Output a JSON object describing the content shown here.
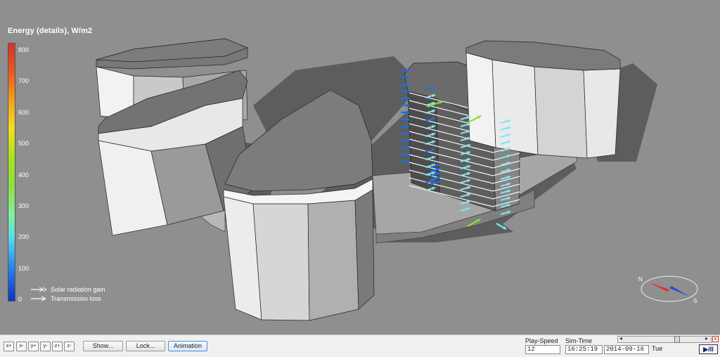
{
  "legend": {
    "title": "Energy (details), W/m2",
    "ticks": [
      "800",
      "700",
      "600",
      "500",
      "400",
      "300",
      "200",
      "100",
      "0"
    ],
    "items": [
      {
        "label": "Solar radiation gain"
      },
      {
        "label": "Transmission loss"
      }
    ]
  },
  "compass": {
    "north": "N",
    "south": "S"
  },
  "toolbar": {
    "axis_buttons": [
      "x+",
      "x-",
      "y+",
      "y-",
      "z+",
      "z-"
    ],
    "show_label": "Show...",
    "lock_label": "Lock...",
    "animation_label": "Animation",
    "play_speed_label": "Play-Speed",
    "play_speed_value": "12",
    "sim_time_label": "Sim-Time",
    "sim_time_value": "16:25:19",
    "sim_date_value": "2014-09-16",
    "weekday": "Tue",
    "slider_left": "◂",
    "slider_right": "▸",
    "close": "x",
    "play_pause": "▶/II"
  },
  "colors": {
    "background": "#8f8f8f",
    "building_light": "#f4f4f4",
    "building_mid": "#c8c8c8",
    "building_dark": "#6e6e6e",
    "shadow": "#5a5a5a",
    "arrow_blue": "#1f6fe0",
    "arrow_cyan": "#7ee8f0",
    "arrow_green": "#8ee030"
  }
}
